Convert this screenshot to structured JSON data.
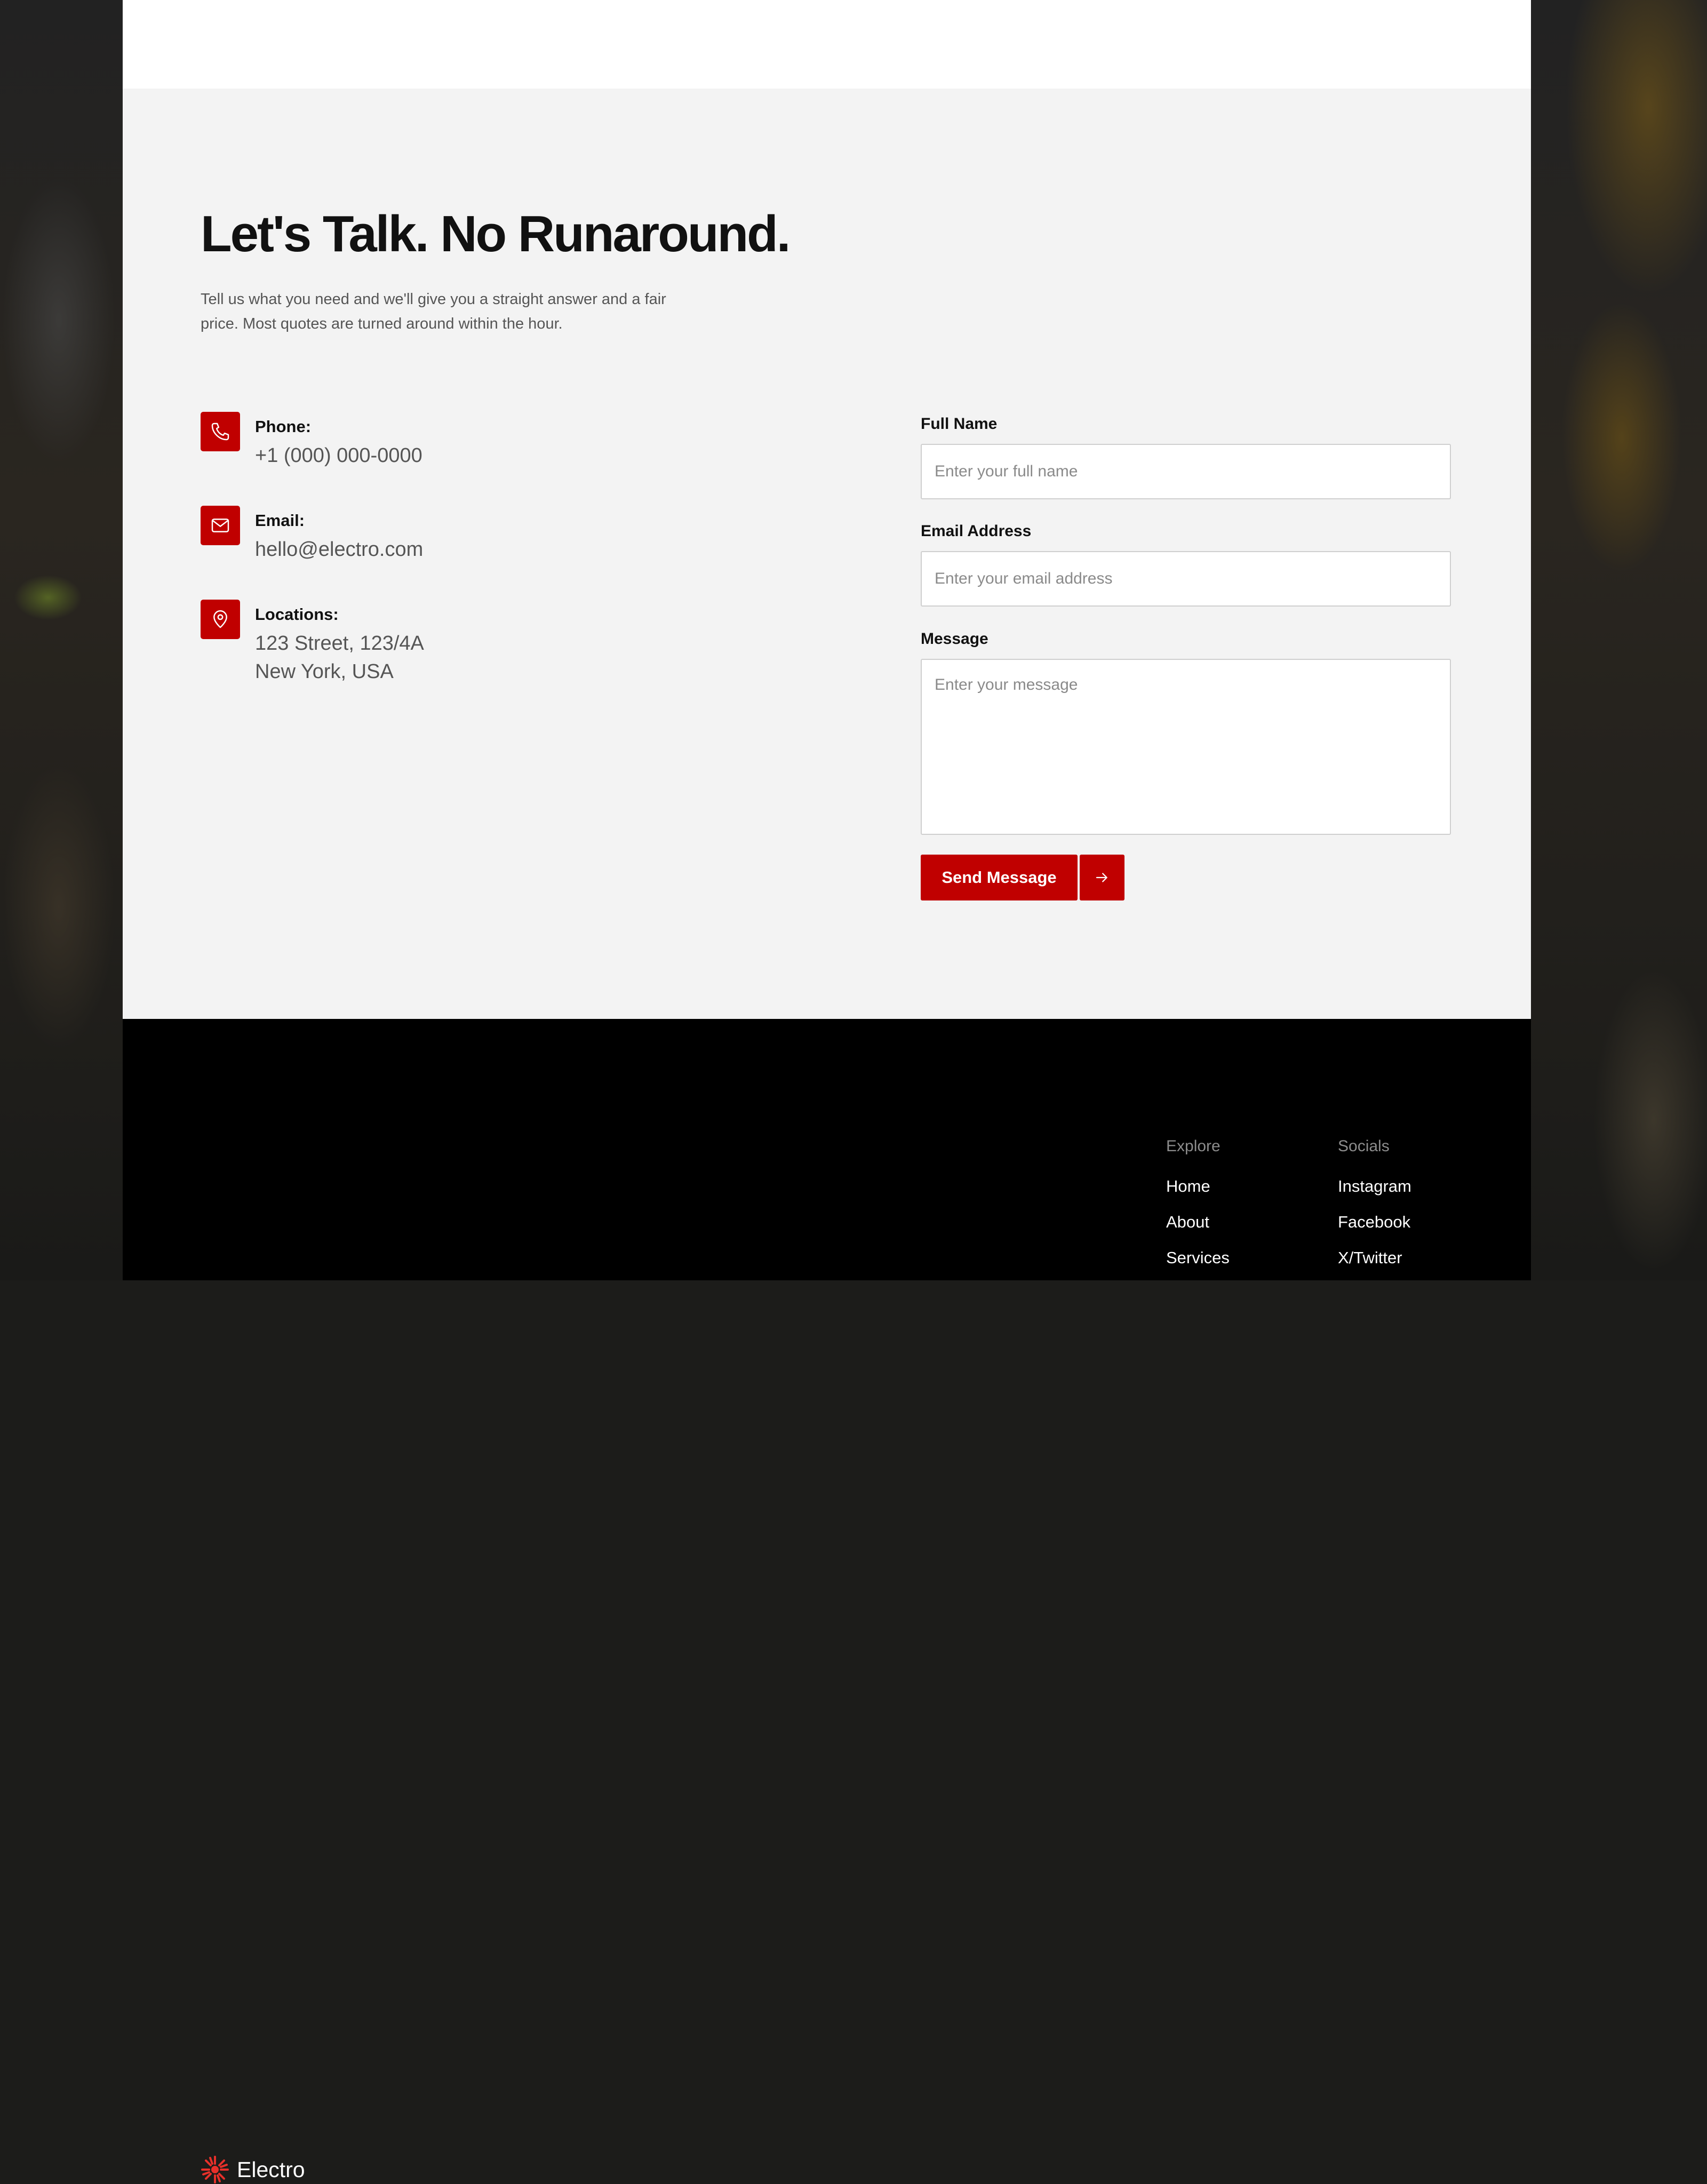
{
  "contact": {
    "heading": "Let's Talk. No Runaround.",
    "intro": "Tell us what you need and we'll give you a straight answer and a fair price. Most quotes are turned around within the hour.",
    "info": {
      "phone": {
        "icon": "phone-icon",
        "label": "Phone:",
        "value": "+1 (000) 000-0000"
      },
      "email": {
        "icon": "mail-icon",
        "label": "Email:",
        "value": "hello@electro.com"
      },
      "location": {
        "icon": "map-pin-icon",
        "label": "Locations:",
        "line1": "123 Street, 123/4A",
        "line2": "New York, USA"
      }
    },
    "form": {
      "full_name": {
        "label": "Full Name",
        "placeholder": "Enter your full name",
        "value": ""
      },
      "email": {
        "label": "Email Address",
        "placeholder": "Enter your email address",
        "value": ""
      },
      "message": {
        "label": "Message",
        "placeholder": "Enter your message",
        "value": ""
      },
      "submit_label": "Send Message",
      "submit_icon": "arrow-right-icon"
    }
  },
  "footer": {
    "brand": {
      "name": "Electro",
      "icon": "sunburst-logo-icon"
    },
    "columns": [
      {
        "heading": "Explore",
        "links": [
          "Home",
          "About",
          "Services"
        ]
      },
      {
        "heading": "Socials",
        "links": [
          "Instagram",
          "Facebook",
          "X/Twitter"
        ]
      }
    ]
  },
  "colors": {
    "accent": "#c00000",
    "section_background": "#f3f3f3",
    "footer_background": "#000000",
    "heading_text": "#111111",
    "body_text": "#555555"
  }
}
